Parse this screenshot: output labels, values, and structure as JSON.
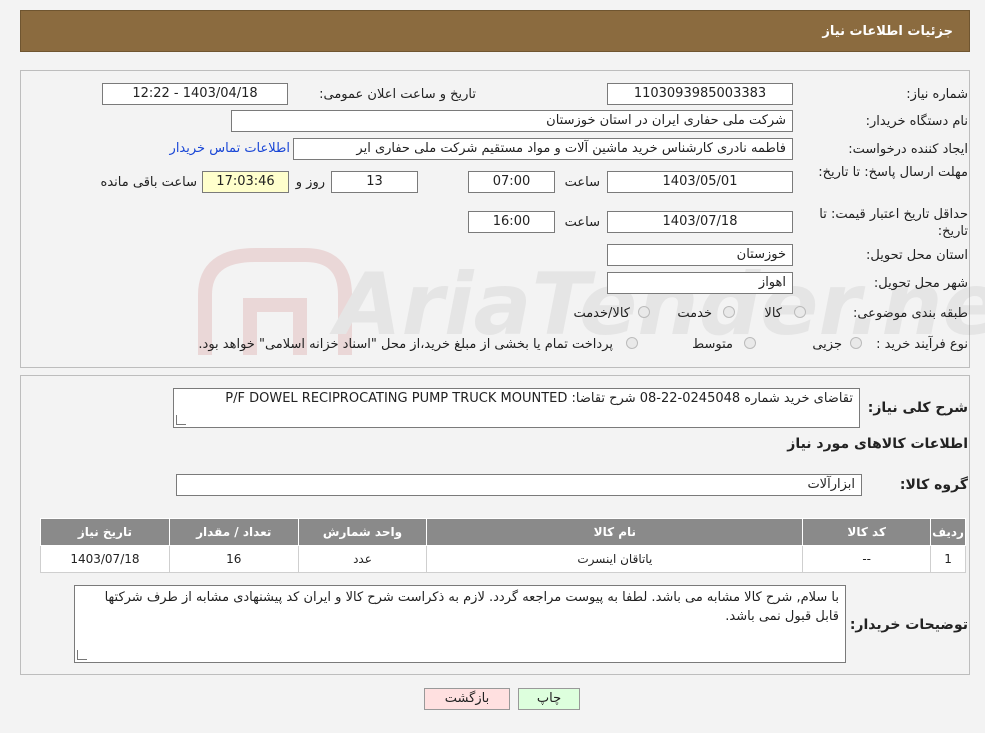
{
  "header": {
    "title": "جزئیات اطلاعات نیاز"
  },
  "need_number": {
    "label": "شماره نیاز:",
    "value": "1103093985003383"
  },
  "announce": {
    "label": "تاریخ و ساعت اعلان عمومی:",
    "value": "1403/04/18 - 12:22"
  },
  "buyer_org": {
    "label": "نام دستگاه خریدار:",
    "value": "شرکت ملی حفاری ایران در استان خوزستان"
  },
  "creator": {
    "label": "ایجاد کننده درخواست:",
    "value": "فاطمه نادری کارشناس خرید ماشین آلات و مواد مستقیم شرکت ملی حفاری ایر",
    "contact_link": "اطلاعات تماس خریدار"
  },
  "deadline": {
    "label": "مهلت ارسال پاسخ: تا تاریخ:",
    "date": "1403/05/01",
    "time_label": "ساعت",
    "time": "07:00",
    "days": "13",
    "days_label": "روز و",
    "remaining": "17:03:46",
    "remaining_label": "ساعت باقی مانده"
  },
  "validity": {
    "label": "حداقل تاریخ اعتبار قیمت: تا تاریخ:",
    "date": "1403/07/18",
    "time_label": "ساعت",
    "time": "16:00"
  },
  "province": {
    "label": "استان محل تحویل:",
    "value": "خوزستان"
  },
  "city": {
    "label": "شهر محل تحویل:",
    "value": "اهواز"
  },
  "category": {
    "label": "طبقه بندی موضوعی:",
    "options": [
      "کالا",
      "خدمت",
      "کالا/خدمت"
    ]
  },
  "purchase_type": {
    "label": "نوع فرآیند خرید :",
    "options": [
      "جزیی",
      "متوسط"
    ],
    "note": "پرداخت تمام یا بخشی از مبلغ خرید،از محل \"اسناد خزانه اسلامی\" خواهد بود."
  },
  "description": {
    "label": "شرح کلی نیاز:",
    "value": "تقاضای خرید شماره 0245048-22-08 شرح تقاضا: P/F DOWEL RECIPROCATING PUMP TRUCK MOUNTED"
  },
  "goods_section": {
    "title": "اطلاعات کالاهای مورد نیاز"
  },
  "goods_group": {
    "label": "گروه کالا:",
    "value": "ابزارآلات"
  },
  "table": {
    "headers": [
      "ردیف",
      "کد کالا",
      "نام کالا",
      "واحد شمارش",
      "تعداد / مقدار",
      "تاریخ نیاز"
    ],
    "rows": [
      [
        "1",
        "--",
        "یاتاقان اینسرت",
        "عدد",
        "16",
        "1403/07/18"
      ]
    ]
  },
  "buyer_notes": {
    "label": "توضیحات خریدار:",
    "value": "با سلام, شرح کالا مشابه می باشد. لطفا به پیوست مراجعه گردد. لازم به ذکراست شرح کالا و ایران کد  پیشنهادی مشابه از طرف شرکتها قابل قبول نمی باشد."
  },
  "buttons": {
    "print": "چاپ",
    "back": "بازگشت"
  },
  "watermark": {
    "text": "AriaTender.neT"
  }
}
